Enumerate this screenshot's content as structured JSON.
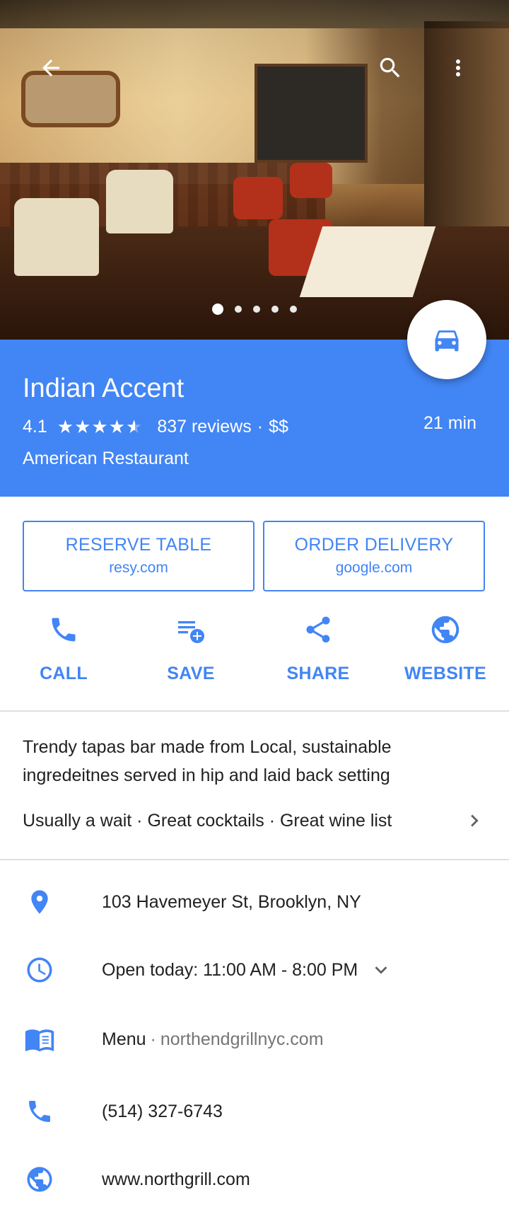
{
  "hero": {
    "photo_description_icon": "restaurant-interior-photo",
    "page_count": 5,
    "active_page": 1
  },
  "place": {
    "name": "Indian Accent",
    "rating": "4.1",
    "rating_value": 4.1,
    "reviews": "837 reviews",
    "separator": "·",
    "price": "$$",
    "category": "American Restaurant",
    "drive_time": "21 min"
  },
  "cta": {
    "reserve": {
      "title": "RESERVE TABLE",
      "sub": "resy.com"
    },
    "delivery": {
      "title": "ORDER DELIVERY",
      "sub": "google.com"
    }
  },
  "actions": [
    {
      "label": "CALL",
      "icon": "phone-icon"
    },
    {
      "label": "SAVE",
      "icon": "playlist-add-icon"
    },
    {
      "label": "SHARE",
      "icon": "share-icon"
    },
    {
      "label": "WEBSITE",
      "icon": "globe-icon"
    }
  ],
  "about": {
    "description": "Trendy tapas bar made from Local, sustainable ingredeitnes served in hip and laid back setting",
    "highlights": "Usually a wait · Great cocktails · Great wine list"
  },
  "info": {
    "address": "103 Havemeyer St, Brooklyn, NY",
    "hours": "Open today: 11:00 AM - 8:00 PM",
    "menu_label": "Menu",
    "menu_sep": "·",
    "menu_site": "northendgrillnyc.com",
    "phone": "(514) 327-6743",
    "website": "www.northgrill.com"
  },
  "colors": {
    "accent": "#4285f4",
    "text": "#212121",
    "muted": "#757575",
    "divider": "#e0e0e0"
  }
}
